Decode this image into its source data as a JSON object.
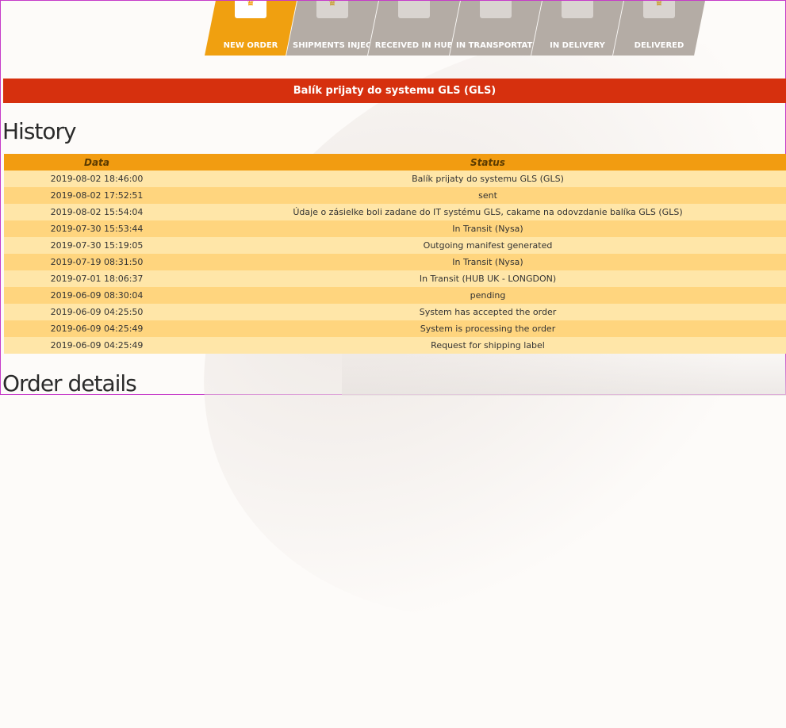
{
  "progress": {
    "steps": [
      {
        "label": "NEW ORDER",
        "active": true,
        "icon": "crown-box-icon"
      },
      {
        "label": "SHIPMENTS INJECTED",
        "active": false,
        "icon": "crown-box-icon"
      },
      {
        "label": "RECEIVED IN HUB",
        "active": false,
        "icon": "warehouse-icon"
      },
      {
        "label": "IN TRANSPORTATIO",
        "active": false,
        "icon": "truck-icon"
      },
      {
        "label": "IN DELIVERY",
        "active": false,
        "icon": "hand-package-icon"
      },
      {
        "label": "DELIVERED",
        "active": false,
        "icon": "crown-box-icon"
      }
    ]
  },
  "banner": {
    "status_text": "Balík prijaty do systemu GLS (GLS)",
    "color": "#d6300e"
  },
  "history": {
    "title": "History",
    "columns": {
      "date": "Data",
      "status": "Status"
    },
    "rows": [
      {
        "date": "2019-08-02 18:46:00",
        "status": "Balík prijaty do systemu GLS (GLS)"
      },
      {
        "date": "2019-08-02 17:52:51",
        "status": "sent"
      },
      {
        "date": "2019-08-02 15:54:04",
        "status": "Údaje o zásielke boli zadane do IT systému GLS, cakame na odovzdanie balíka GLS (GLS)"
      },
      {
        "date": "2019-07-30 15:53:44",
        "status": "In Transit (Nysa)"
      },
      {
        "date": "2019-07-30 15:19:05",
        "status": "Outgoing manifest generated"
      },
      {
        "date": "2019-07-19 08:31:50",
        "status": "In Transit (Nysa)"
      },
      {
        "date": "2019-07-01 18:06:37",
        "status": "In Transit (HUB UK - LONGDON)"
      },
      {
        "date": "2019-06-09 08:30:04",
        "status": "pending"
      },
      {
        "date": "2019-06-09 04:25:50",
        "status": "System has accepted the order"
      },
      {
        "date": "2019-06-09 04:25:49",
        "status": "System is processing the order"
      },
      {
        "date": "2019-06-09 04:25:49",
        "status": "Request for shipping label"
      }
    ]
  },
  "order_details": {
    "title": "Order details"
  },
  "colors": {
    "accent": "#f29c11",
    "active_step": "#f0a010",
    "inactive_step": "#b4aca5",
    "row_light": "#ffe6a8",
    "row_dark": "#ffd57e"
  }
}
